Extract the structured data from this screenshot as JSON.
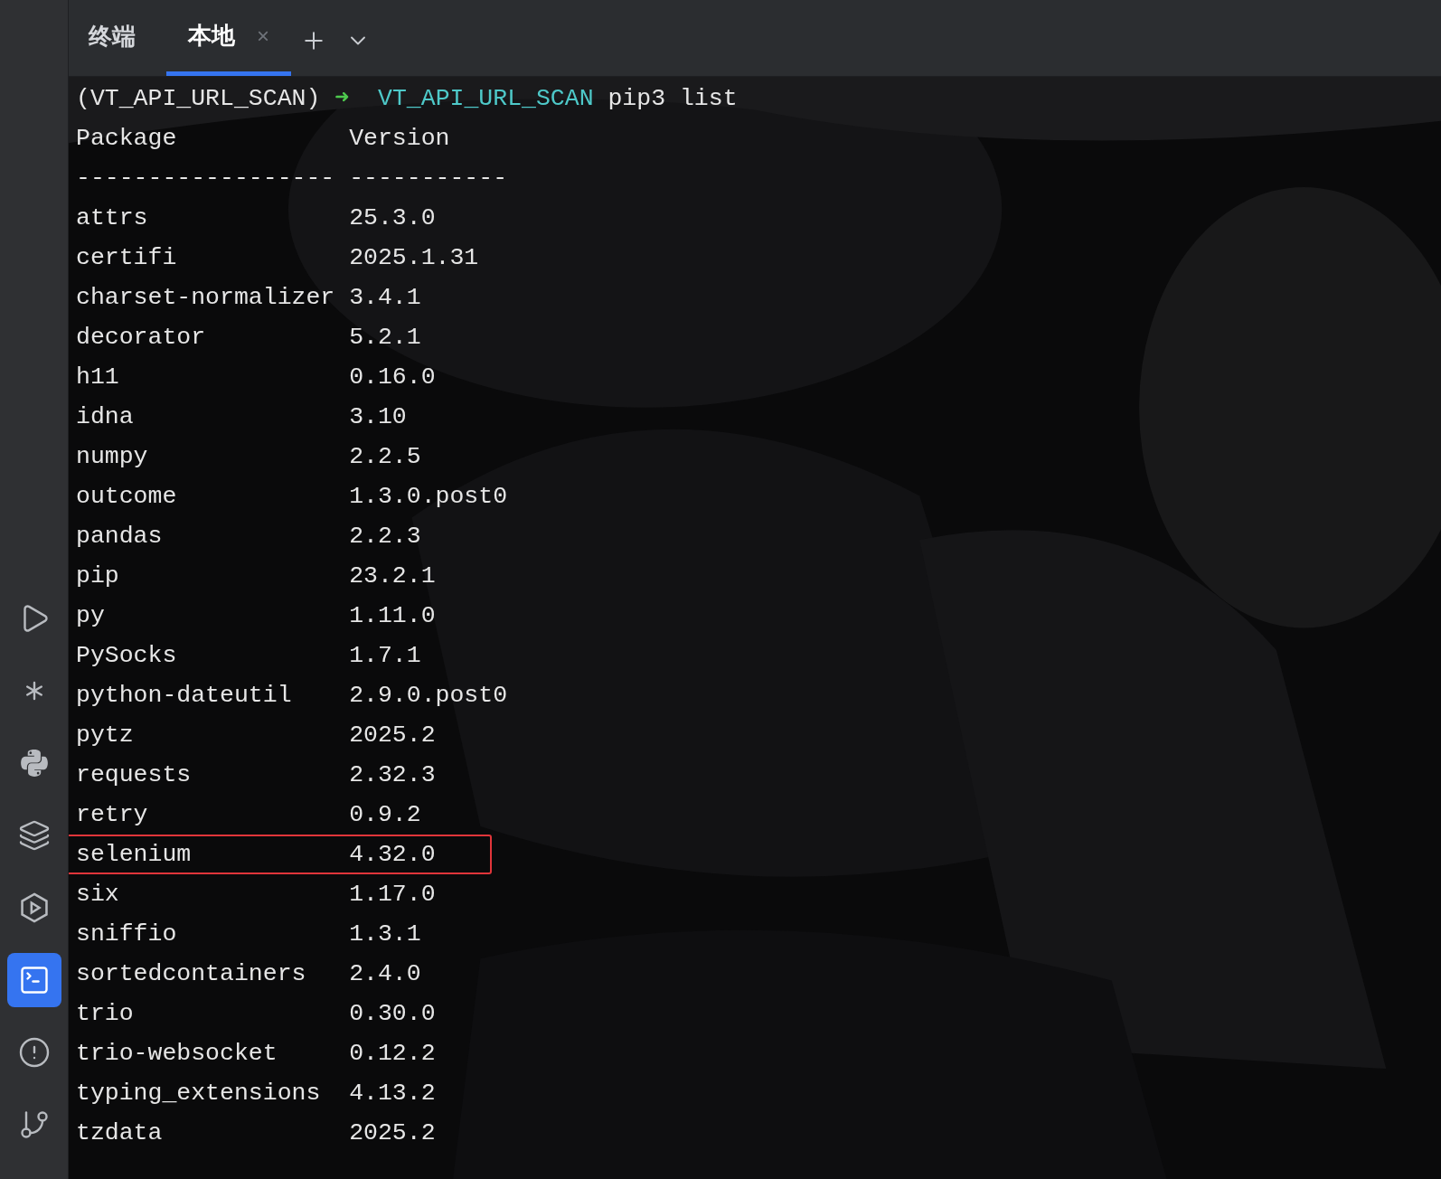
{
  "tool_window": {
    "title": "终端"
  },
  "tabs": [
    {
      "label": "本地",
      "selected": true,
      "close": "×"
    }
  ],
  "sidebar": {
    "items": [
      {
        "kind": "run",
        "selected": false
      },
      {
        "kind": "services",
        "selected": false
      },
      {
        "kind": "python",
        "selected": false
      },
      {
        "kind": "layers",
        "selected": false
      },
      {
        "kind": "hexplay",
        "selected": false
      },
      {
        "kind": "terminal",
        "selected": true
      },
      {
        "kind": "problems",
        "selected": false
      },
      {
        "kind": "git",
        "selected": false
      }
    ]
  },
  "terminal": {
    "prompt": {
      "env": "(VT_API_URL_SCAN)",
      "arrow": "➜",
      "dir": "VT_API_URL_SCAN",
      "command": "pip3 list"
    },
    "header": [
      "Package",
      "Version"
    ],
    "separator": [
      "------------------",
      "-----------"
    ],
    "rows": [
      {
        "package": "attrs",
        "version": "25.3.0",
        "highlighted": false
      },
      {
        "package": "certifi",
        "version": "2025.1.31",
        "highlighted": false
      },
      {
        "package": "charset-normalizer",
        "version": "3.4.1",
        "highlighted": false
      },
      {
        "package": "decorator",
        "version": "5.2.1",
        "highlighted": false
      },
      {
        "package": "h11",
        "version": "0.16.0",
        "highlighted": false
      },
      {
        "package": "idna",
        "version": "3.10",
        "highlighted": false
      },
      {
        "package": "numpy",
        "version": "2.2.5",
        "highlighted": false
      },
      {
        "package": "outcome",
        "version": "1.3.0.post0",
        "highlighted": false
      },
      {
        "package": "pandas",
        "version": "2.2.3",
        "highlighted": false
      },
      {
        "package": "pip",
        "version": "23.2.1",
        "highlighted": false
      },
      {
        "package": "py",
        "version": "1.11.0",
        "highlighted": false
      },
      {
        "package": "PySocks",
        "version": "1.7.1",
        "highlighted": false
      },
      {
        "package": "python-dateutil",
        "version": "2.9.0.post0",
        "highlighted": false
      },
      {
        "package": "pytz",
        "version": "2025.2",
        "highlighted": false
      },
      {
        "package": "requests",
        "version": "2.32.3",
        "highlighted": false
      },
      {
        "package": "retry",
        "version": "0.9.2",
        "highlighted": false
      },
      {
        "package": "selenium",
        "version": "4.32.0",
        "highlighted": true
      },
      {
        "package": "six",
        "version": "1.17.0",
        "highlighted": false
      },
      {
        "package": "sniffio",
        "version": "1.3.1",
        "highlighted": false
      },
      {
        "package": "sortedcontainers",
        "version": "2.4.0",
        "highlighted": false
      },
      {
        "package": "trio",
        "version": "0.30.0",
        "highlighted": false
      },
      {
        "package": "trio-websocket",
        "version": "0.12.2",
        "highlighted": false
      },
      {
        "package": "typing_extensions",
        "version": "4.13.2",
        "highlighted": false
      },
      {
        "package": "tzdata",
        "version": "2025.2",
        "highlighted": false
      }
    ]
  }
}
